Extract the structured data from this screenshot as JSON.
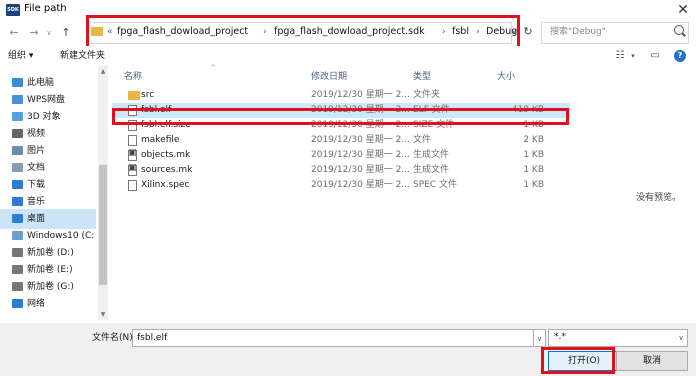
{
  "window": {
    "title": "File path",
    "app_badge": "SDK"
  },
  "nav": {
    "back": "←",
    "forward": "→",
    "up": "↑",
    "recent": "∨"
  },
  "address": {
    "prefix": "«",
    "crumbs": [
      "fpga_flash_dowload_project",
      "fpga_flash_dowload_project.sdk",
      "fsbl",
      "Debug"
    ],
    "separator": "›"
  },
  "search": {
    "placeholder": "搜索\"Debug\""
  },
  "toolbar": {
    "organize": "组织 ▾",
    "new_folder": "新建文件夹"
  },
  "sidebar": {
    "items": [
      {
        "label": "此电脑",
        "icon": "computer-icon",
        "color": "#3a8ad6"
      },
      {
        "label": "WPS网盘",
        "icon": "cloud-icon",
        "color": "#4a90d9"
      },
      {
        "label": "3D 对象",
        "icon": "cube-icon",
        "color": "#4fa3e0"
      },
      {
        "label": "视频",
        "icon": "video-icon",
        "color": "#666666"
      },
      {
        "label": "图片",
        "icon": "picture-icon",
        "color": "#6b8fb0"
      },
      {
        "label": "文档",
        "icon": "document-icon",
        "color": "#8a9bb0"
      },
      {
        "label": "下载",
        "icon": "download-icon",
        "color": "#2d7dd2"
      },
      {
        "label": "音乐",
        "icon": "music-icon",
        "color": "#2d7dd2"
      },
      {
        "label": "桌面",
        "icon": "desktop-icon",
        "color": "#2d7dd2"
      },
      {
        "label": "Windows10 (C:",
        "icon": "drive-c-icon",
        "color": "#6aa0cf"
      },
      {
        "label": "新加卷 (D:)",
        "icon": "drive-icon",
        "color": "#777777"
      },
      {
        "label": "新加卷 (E:)",
        "icon": "drive-icon",
        "color": "#777777"
      },
      {
        "label": "新加卷 (G:)",
        "icon": "drive-icon",
        "color": "#777777"
      },
      {
        "label": "网络",
        "icon": "network-icon",
        "color": "#2d7dd2"
      }
    ]
  },
  "columns": {
    "name": "名称",
    "date": "修改日期",
    "type": "类型",
    "size": "大小"
  },
  "files": [
    {
      "name": "src",
      "date": "2019/12/30 星期一 2...",
      "type": "文件夹",
      "size": "",
      "icon": "folder-icon"
    },
    {
      "name": "fsbl.elf",
      "date": "2019/12/30 星期一 2...",
      "type": "ELF 文件",
      "size": "419 KB",
      "icon": "file-icon"
    },
    {
      "name": "fsbl.elf.size",
      "date": "2019/12/30 星期一 2...",
      "type": "SIZE 文件",
      "size": "1 KB",
      "icon": "file-icon"
    },
    {
      "name": "makefile",
      "date": "2019/12/30 星期一 2...",
      "type": "文件",
      "size": "2 KB",
      "icon": "file-icon"
    },
    {
      "name": "objects.mk",
      "date": "2019/12/30 星期一 2...",
      "type": "生成文件",
      "size": "1 KB",
      "icon": "makefile-icon"
    },
    {
      "name": "sources.mk",
      "date": "2019/12/30 星期一 2...",
      "type": "生成文件",
      "size": "1 KB",
      "icon": "makefile-icon"
    },
    {
      "name": "Xilinx.spec",
      "date": "2019/12/30 星期一 2...",
      "type": "SPEC 文件",
      "size": "1 KB",
      "icon": "file-icon"
    }
  ],
  "preview": {
    "empty_text": "没有预览。"
  },
  "footer": {
    "filename_label": "文件名(N):",
    "filename_value": "fsbl.elf",
    "filter_value": "*.*",
    "open_label": "打开(O)",
    "cancel_label": "取消"
  },
  "colors": {
    "highlight_box": "#e0101e",
    "selected_row": "#cce8ff",
    "sidebar_selected": "#cce4f7"
  }
}
